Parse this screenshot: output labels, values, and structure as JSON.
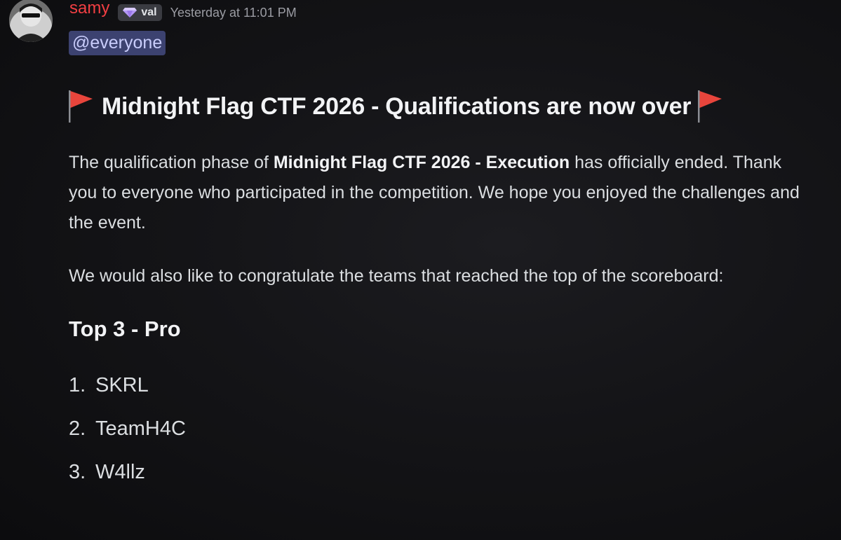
{
  "author": {
    "username": "samy",
    "role_tag": "val",
    "role_icon": "gem-icon",
    "timestamp": "Yesterday at 11:01 PM"
  },
  "mention": "@everyone",
  "headline": {
    "icon": "red-triangular-flag",
    "text": "Midnight Flag CTF 2026 - Qualifications are now over"
  },
  "intro": {
    "before": "The qualification phase of ",
    "bold": "Midnight Flag CTF 2026 - Execution",
    "after": " has officially ended. Thank you to everyone who participated in the competition. We hope you enjoyed the challenges and the event."
  },
  "congrats": "We would also like to congratulate the teams that reached the top of the scoreboard:",
  "top_section": {
    "title": "Top 3 - Pro",
    "teams": [
      {
        "rank": "1.",
        "name": "SKRL"
      },
      {
        "rank": "2.",
        "name": "TeamH4C"
      },
      {
        "rank": "3.",
        "name": "W4llz"
      }
    ]
  },
  "colors": {
    "username": "#f23f43",
    "mention_bg": "#3c4270",
    "mention_text": "#c9cdfb",
    "flag": "#e8453c"
  }
}
